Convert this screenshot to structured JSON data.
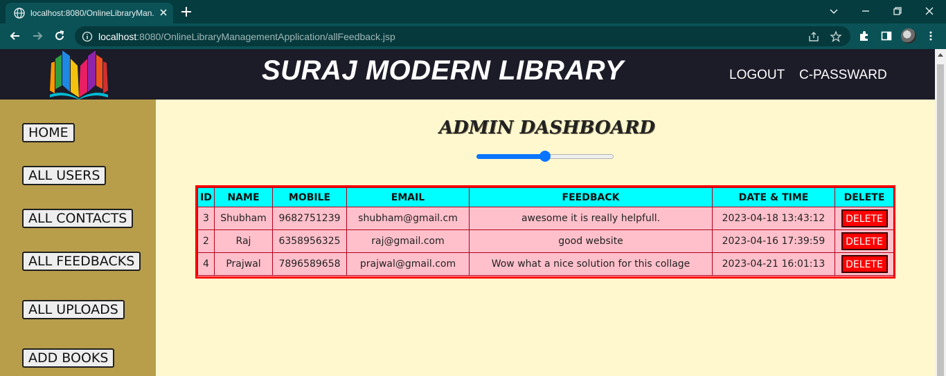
{
  "browser": {
    "tab_title": "localhost:8080/OnlineLibraryMan...",
    "url_host": "localhost",
    "url_rest": ":8080/OnlineLibraryManagementApplication/allFeedback.jsp"
  },
  "header": {
    "site_title": "SURAJ MODERN LIBRARY",
    "nav": [
      "LOGOUT",
      "C-PASSWARD"
    ]
  },
  "sidebar": {
    "items": [
      "HOME",
      "ALL USERS",
      "ALL CONTACTS",
      "ALL FEEDBACKS",
      "ALL UPLOADS",
      "ADD BOOKS"
    ]
  },
  "main": {
    "title": "ADMIN DASHBOARD",
    "slider_value_percent": 50,
    "table": {
      "headers": [
        "ID",
        "NAME",
        "MOBILE",
        "EMAIL",
        "FEEDBACK",
        "DATE & TIME",
        "DELETE"
      ],
      "rows": [
        {
          "id": "3",
          "name": "Shubham",
          "mobile": "9682751239",
          "email": "shubham@gmail.cm",
          "feedback": "awesome it is really helpfull.",
          "datetime": "2023-04-18 13:43:12",
          "action": "DELETE"
        },
        {
          "id": "2",
          "name": "Raj",
          "mobile": "6358956325",
          "email": "raj@gmail.com",
          "feedback": "good website",
          "datetime": "2023-04-16 17:39:59",
          "action": "DELETE"
        },
        {
          "id": "4",
          "name": "Prajwal",
          "mobile": "7896589658",
          "email": "prajwal@gmail.com",
          "feedback": "Wow what a nice solution for this collage",
          "datetime": "2023-04-21 16:01:13",
          "action": "DELETE"
        }
      ]
    }
  },
  "colors": {
    "header_bg": "#1c1b28",
    "sidebar_bg": "#b89e4b",
    "content_bg": "#fff8cf",
    "table_header_bg": "#00ffff",
    "table_row_bg": "#ffc0cb",
    "table_border": "#ff0000",
    "delete_button": "#ff0000",
    "slider_accent": "#0a75ff"
  }
}
